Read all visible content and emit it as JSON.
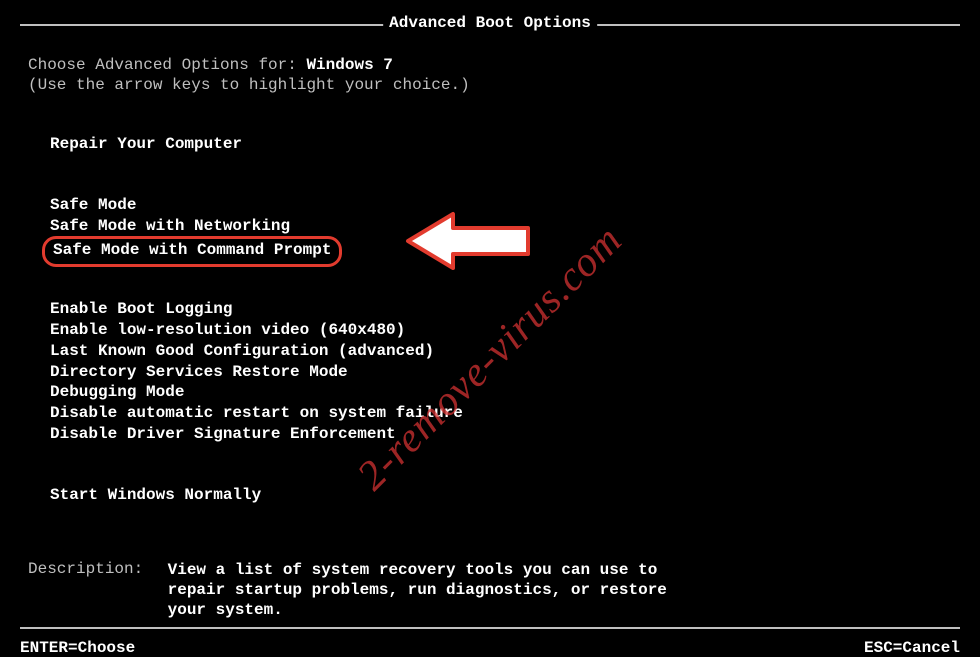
{
  "title": "Advanced Boot Options",
  "intro": {
    "prefix": "Choose Advanced Options for: ",
    "os": "Windows 7",
    "hint": "(Use the arrow keys to highlight your choice.)"
  },
  "groups": {
    "repair": [
      "Repair Your Computer"
    ],
    "safe": [
      "Safe Mode",
      "Safe Mode with Networking",
      "Safe Mode with Command Prompt"
    ],
    "advanced": [
      "Enable Boot Logging",
      "Enable low-resolution video (640x480)",
      "Last Known Good Configuration (advanced)",
      "Directory Services Restore Mode",
      "Debugging Mode",
      "Disable automatic restart on system failure",
      "Disable Driver Signature Enforcement"
    ],
    "normal": [
      "Start Windows Normally"
    ]
  },
  "highlighted_item": "Safe Mode with Command Prompt",
  "description": {
    "label": "Description:",
    "text": "View a list of system recovery tools you can use to repair startup problems, run diagnostics, or restore your system."
  },
  "footer": {
    "enter": "ENTER=Choose",
    "esc": "ESC=Cancel"
  },
  "watermark": "2-remove-virus.com"
}
